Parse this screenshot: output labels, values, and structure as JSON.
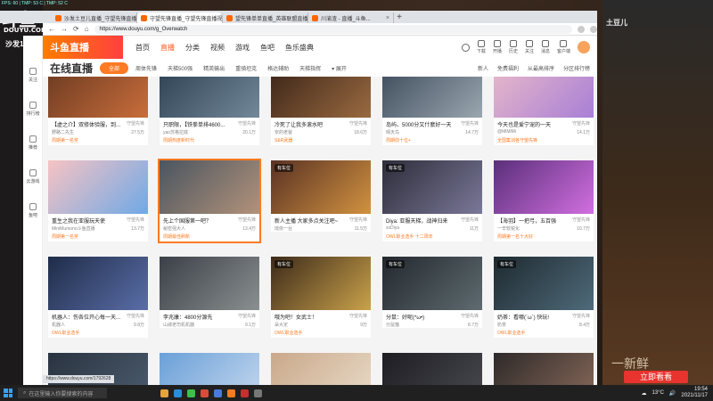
{
  "overlay": {
    "logo": "斗鱼",
    "logo_sub": "DOUYU.COM",
    "left_tag": "沙发1号",
    "stream_title": "土豆儿",
    "watermark": "一新鲜",
    "follow_label": "立即看看",
    "system_stats": "FPS: 60 | TMP: 53 C | TMP: 52 C"
  },
  "tabs": [
    {
      "label": "沙发土豆儿直播_守望先锋直播",
      "active": false
    },
    {
      "label": "守望先锋直播_守望先锋直播视频",
      "active": true
    },
    {
      "label": "望先锋单单直播_英雄联盟直播",
      "active": false
    },
    {
      "label": "川渝渣 - 直播_斗鱼...",
      "active": false
    }
  ],
  "address": {
    "url": "https://www.douyu.com/g_Overwatch"
  },
  "site_nav": {
    "logo": "斗鱼直播",
    "items": [
      {
        "label": "首页",
        "active": false
      },
      {
        "label": "直播",
        "active": true
      },
      {
        "label": "分类",
        "active": false
      },
      {
        "label": "视频",
        "active": false
      },
      {
        "label": "游戏",
        "active": false
      },
      {
        "label": "鱼吧",
        "active": false
      },
      {
        "label": "鱼乐盛典",
        "active": false
      }
    ],
    "right_icons": [
      "下载",
      "开播",
      "历史",
      "关注",
      "消息",
      "客户端"
    ]
  },
  "sidebar": [
    {
      "label": "关注"
    },
    {
      "label": "排行榜"
    },
    {
      "label": "推荐"
    },
    {
      "label": "云游戏"
    },
    {
      "label": "鱼吧"
    }
  ],
  "category": {
    "title": "在线直播",
    "all_label": "全部",
    "filters": [
      "周体先锋",
      "天梯500强",
      "精英输出",
      "重骑坦克",
      "格达辅助",
      "天梯指挥"
    ],
    "more_label": "展开",
    "right": [
      "新人",
      "免费福利",
      "从最高排序",
      "分区排行榜"
    ]
  },
  "cards": [
    {
      "title": "【虚之介】双修体验服，到...",
      "author": "野路二先生",
      "viewers": "27.5万",
      "cat": "守望先锋",
      "tag": "周期第一名奖",
      "c1": "#6a3a22",
      "c2": "#c96d3a",
      "badge": ""
    },
    {
      "title": "只职限，【铁拳单排4600...",
      "author": "yao苏格拉底",
      "viewers": "20.1万",
      "cat": "守望先锋",
      "tag": "周期热度新时代",
      "c1": "#2c4052",
      "c2": "#738899",
      "badge": ""
    },
    {
      "title": "冷死了让我多滚水吧",
      "author": "安的老爸",
      "viewers": "18.6万",
      "cat": "守望先锋",
      "tag": "S&R武器",
      "c1": "#3a2418",
      "c2": "#9a6a40",
      "badge": ""
    },
    {
      "title": "岛屿、5000分又什麼好一天",
      "author": "晴天鸟",
      "viewers": "14.7万",
      "cat": "守望先锋",
      "tag": "周期前十位+",
      "c1": "#3d4a5a",
      "c2": "#9aa7b0",
      "badge": ""
    },
    {
      "title": "今天也是爱宁宠的一天",
      "author": "@MiMiMi",
      "viewers": "14.1万",
      "cat": "守望先锋",
      "tag": "全国集训各守望先锋",
      "c1": "#e9b9c9",
      "c2": "#a87fd6",
      "badge": ""
    },
    {
      "title": "重生之我在亚服玩天使",
      "author": "MiniMumono斗鱼直播",
      "viewers": "13.7万",
      "cat": "守望先锋",
      "tag": "周期第一名奖",
      "c1": "#f7c3c3",
      "c2": "#6fa9e6",
      "badge": ""
    },
    {
      "title": "先上个国服第一吧？",
      "author": "秘密强大人",
      "viewers": "13.4万",
      "cat": "守望先锋",
      "tag": "周期最佳刷新",
      "c1": "#4a5560",
      "c2": "#b2927a",
      "badge": "",
      "featured": true
    },
    {
      "title": "新人主播 大家多点关注吧~",
      "author": "琉依一台",
      "viewers": "11.5万",
      "cat": "守望先锋",
      "tag": "",
      "c1": "#5a3224",
      "c2": "#d1923f",
      "badge": "有车位"
    },
    {
      "title": "Diya: 亚服天梯，战神归来",
      "author": "xxDiya",
      "viewers": "11万",
      "cat": "守望先锋",
      "tag": "OWL职业选手  十二周年",
      "c1": "#2d2d3a",
      "c2": "#7a7898",
      "badge": "有车位"
    },
    {
      "title": "【海羽】一把弓，五百强",
      "author": "一辛软锐化",
      "viewers": "10.7万",
      "cat": "守望先锋",
      "tag": "周期第一名十大好",
      "c1": "#5a2f7a",
      "c2": "#d16fe0",
      "badge": ""
    },
    {
      "title": "机器人：伤各位开心每一天...",
      "author": "机器人",
      "viewers": "9.8万",
      "cat": "守望先锋",
      "tag": "OWL职业选手",
      "c1": "#1f2c48",
      "c2": "#5a6ea8",
      "badge": ""
    },
    {
      "title": "李兆康：4800分源先",
      "author": "山城老司机机器",
      "viewers": "9.1万",
      "cat": "守望先锋",
      "tag": "",
      "c1": "#3b4048",
      "c2": "#8a8f90",
      "badge": ""
    },
    {
      "title": "哦为吧！女武士！",
      "author": "朵大定",
      "viewers": "9万",
      "cat": "守望先锋",
      "tag": "OWL职业选手",
      "c1": "#3d2a1a",
      "c2": "#c9a24a",
      "badge": "有车位"
    },
    {
      "title": "分鼠：好呢(*ω•)",
      "author": "分鼠猫",
      "viewers": "8.7万",
      "cat": "守望先锋",
      "tag": "",
      "c1": "#23282e",
      "c2": "#5e6b70",
      "badge": "有车位"
    },
    {
      "title": "奶茶：看哪(´ω`) 快玩!",
      "author": "奶茶",
      "viewers": "8.4万",
      "cat": "守望先锋",
      "tag": "OWL职业选手",
      "c1": "#1e2a30",
      "c2": "#4f6a7a",
      "badge": "有车位"
    },
    {
      "title": "",
      "author": "",
      "viewers": "",
      "cat": "",
      "tag": "",
      "c1": "#2a3340",
      "c2": "#4c5d70",
      "badge": ""
    },
    {
      "title": "",
      "author": "",
      "viewers": "",
      "cat": "",
      "tag": "",
      "c1": "#6aa0d8",
      "c2": "#c7d9ee",
      "badge": ""
    },
    {
      "title": "",
      "author": "",
      "viewers": "",
      "cat": "",
      "tag": "",
      "c1": "#caa88a",
      "c2": "#e9dcc9",
      "badge": ""
    },
    {
      "title": "",
      "author": "",
      "viewers": "",
      "cat": "",
      "tag": "",
      "c1": "#1d1d22",
      "c2": "#4a4a52",
      "badge": ""
    },
    {
      "title": "",
      "author": "",
      "viewers": "",
      "cat": "",
      "tag": "",
      "c1": "#2e2a2a",
      "c2": "#8a6a5a",
      "badge": ""
    }
  ],
  "status_url": "https://www.douyu.com/1792628",
  "taskbar": {
    "search_placeholder": "在这里输入你要搜索的内容",
    "tray_temp": "13°C",
    "time": "19:54",
    "date": "2021/11/17"
  }
}
